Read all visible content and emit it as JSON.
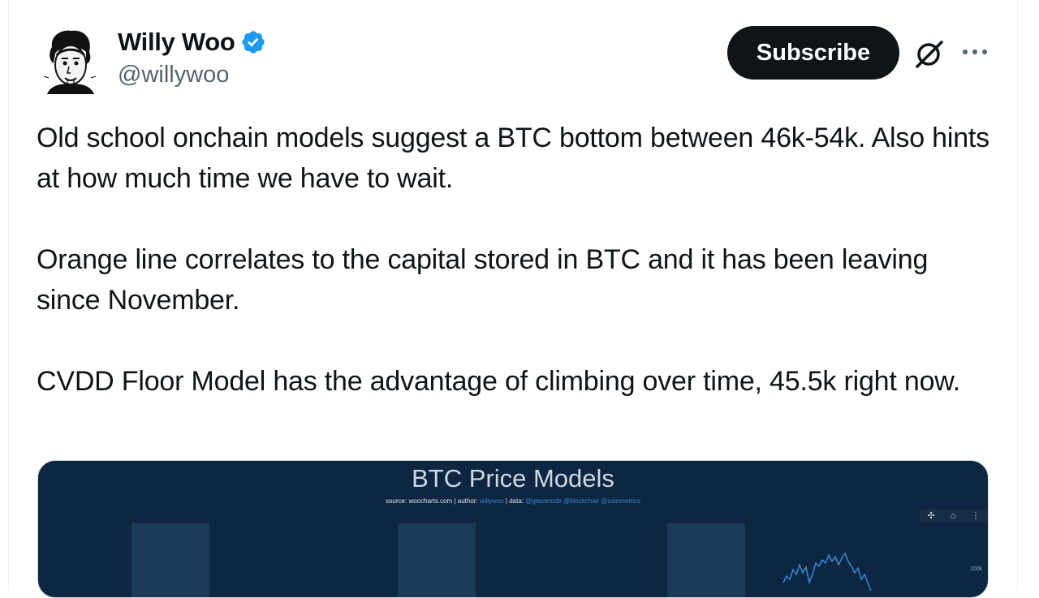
{
  "author": {
    "name": "Willy Woo",
    "handle": "@willywoo",
    "verified_icon": "verified-badge-icon",
    "verified_color": "#1d9bf0"
  },
  "actions": {
    "subscribe_label": "Subscribe",
    "grok_icon": "grok-icon",
    "more_icon": "more-options-icon"
  },
  "tweet": {
    "paragraphs": [
      "Old school onchain models suggest a BTC bottom between 46k-54k. Also hints at how much time we have to wait.",
      "Orange line correlates to the capital stored in BTC and it has been leaving since November.",
      "CVDD Floor Model has the advantage of climbing over time, 45.5k right now."
    ]
  },
  "media": {
    "background_color": "#0d2742",
    "title": "BTC Price Models",
    "source_prefix": "source: ",
    "source_site": "woocharts.com",
    "author_prefix": " | author: ",
    "author_name": "willywoo",
    "data_prefix": " | data: ",
    "data_sources": "@glassnode @blockchair @coinmetrics",
    "axis_label": "100k",
    "toolbar_icons": [
      "move-icon",
      "home-icon",
      "menu-icon"
    ]
  }
}
